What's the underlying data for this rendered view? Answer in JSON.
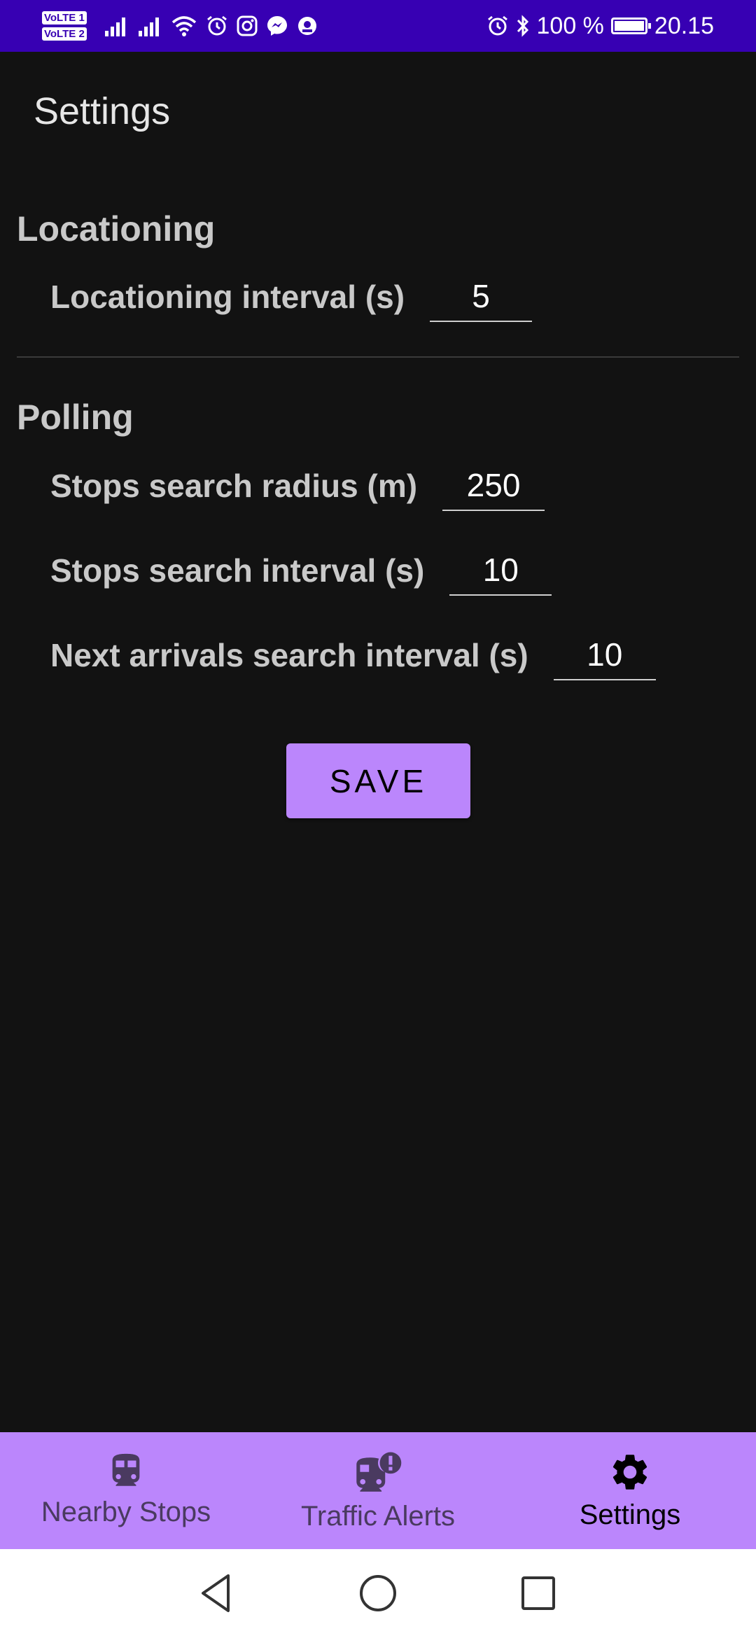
{
  "status_bar": {
    "sim1": "VoLTE 1",
    "sim2": "VoLTE 2",
    "icons": [
      "signal-1-icon",
      "signal-2-icon",
      "wifi-icon",
      "alarm-icon",
      "instagram-icon",
      "messenger-icon",
      "app-notification-icon"
    ],
    "right_icons": [
      "alarm-icon",
      "bluetooth-icon",
      "battery-charging-icon"
    ],
    "battery_percent": "100 %",
    "battery_level": 1.0,
    "time": "20.15",
    "color": "#3700b3"
  },
  "header": {
    "title": "Settings"
  },
  "sections": [
    {
      "title": "Locationing",
      "settings": [
        {
          "label": "Locationing interval (s)",
          "value": "5"
        }
      ]
    },
    {
      "title": "Polling",
      "settings": [
        {
          "label": "Stops search radius (m)",
          "value": "250"
        },
        {
          "label": "Stops search interval (s)",
          "value": "10"
        },
        {
          "label": "Next arrivals search interval (s)",
          "value": "10"
        }
      ]
    }
  ],
  "save_button": {
    "label": "SAVE",
    "color": "#bb86fc"
  },
  "bottom_nav": {
    "items": [
      {
        "label": "Nearby Stops",
        "icon": "train-icon",
        "active": false
      },
      {
        "label": "Traffic Alerts",
        "icon": "train-alert-icon",
        "active": false
      },
      {
        "label": "Settings",
        "icon": "gear-icon",
        "active": true
      }
    ],
    "color": "#bb86fc"
  },
  "system_nav": {
    "buttons": [
      "back-icon",
      "home-icon",
      "recents-icon"
    ]
  }
}
